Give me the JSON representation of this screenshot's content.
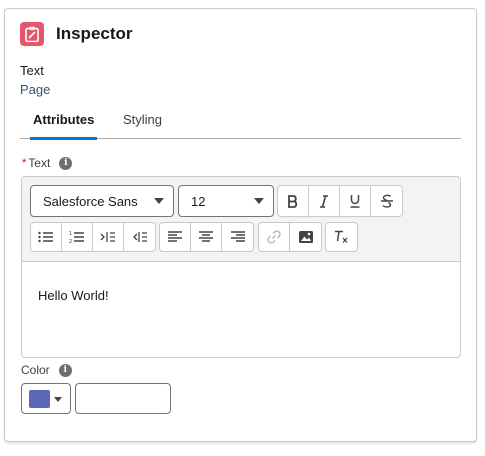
{
  "header": {
    "title": "Inspector",
    "icon": "clipboard-icon",
    "icon_color": "#e3566e"
  },
  "context": {
    "type": "Text",
    "name": "Page"
  },
  "tabs": [
    {
      "label": "Attributes",
      "active": true
    },
    {
      "label": "Styling",
      "active": false
    }
  ],
  "text_field": {
    "required_marker": "*",
    "label": "Text",
    "info_icon": "info-icon",
    "toolbar": {
      "font_family": "Salesforce Sans",
      "font_size": "12",
      "format_buttons": [
        "bold-icon",
        "italic-icon",
        "underline-icon",
        "strikethrough-icon"
      ],
      "list_buttons": [
        "bulleted-list-icon",
        "numbered-list-icon",
        "indent-icon",
        "outdent-icon"
      ],
      "align_buttons": [
        "align-left-icon",
        "align-center-icon",
        "align-right-icon"
      ],
      "insert_buttons": [
        "link-icon",
        "image-icon"
      ],
      "clear_button": "clear-formatting-icon"
    },
    "value": "Hello World!"
  },
  "color_field": {
    "label": "Color",
    "info_icon": "info-icon",
    "swatch_color": "#5a6ab5",
    "value": ""
  }
}
